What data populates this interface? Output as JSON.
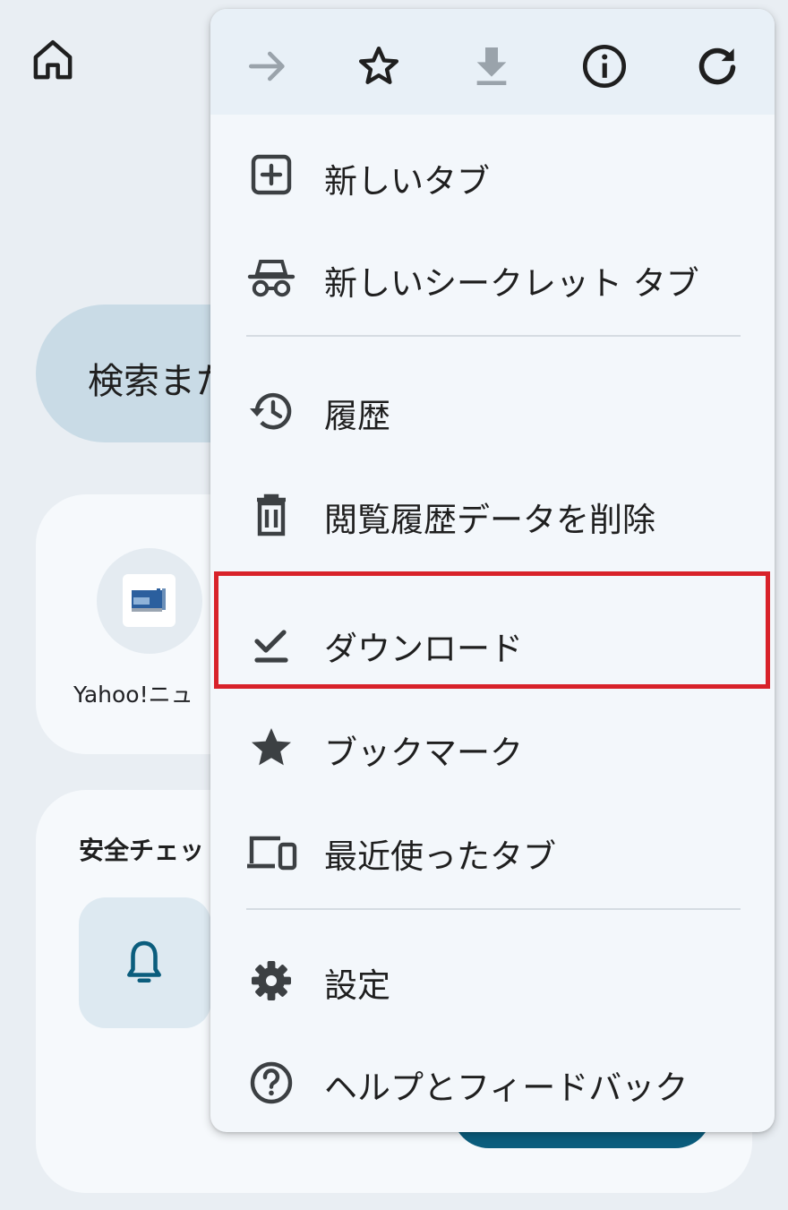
{
  "background": {
    "search_text": "検索また",
    "shortcut_tile": {
      "label": "Yahoo!ニュ"
    },
    "safety_card": {
      "title": "安全チェッ"
    }
  },
  "menu": {
    "toolbar": [
      {
        "name": "forward",
        "icon": "arrow-right-icon",
        "enabled": false
      },
      {
        "name": "bookmark",
        "icon": "star-outline-icon",
        "enabled": true
      },
      {
        "name": "download-page",
        "icon": "download-icon",
        "enabled": false
      },
      {
        "name": "page-info",
        "icon": "info-icon",
        "enabled": true
      },
      {
        "name": "reload",
        "icon": "refresh-icon",
        "enabled": true
      }
    ],
    "items": [
      {
        "label": "新しいタブ",
        "icon": "new-tab-icon"
      },
      {
        "label": "新しいシークレット タブ",
        "icon": "incognito-icon"
      },
      {
        "label": "履歴",
        "icon": "history-icon"
      },
      {
        "label": "閲覧履歴データを削除",
        "icon": "trash-icon"
      },
      {
        "label": "ダウンロード",
        "icon": "download-done-icon",
        "highlighted": true
      },
      {
        "label": "ブックマーク",
        "icon": "star-filled-icon"
      },
      {
        "label": "最近使ったタブ",
        "icon": "devices-icon"
      },
      {
        "label": "設定",
        "icon": "gear-icon"
      },
      {
        "label": "ヘルプとフィードバック",
        "icon": "help-icon"
      }
    ]
  },
  "colors": {
    "highlight_border": "#d8222a",
    "menu_background": "#f3f7fb",
    "accent_teal": "#0b5d7d"
  }
}
